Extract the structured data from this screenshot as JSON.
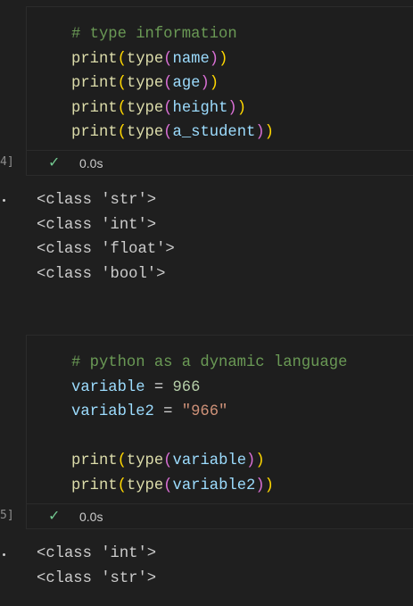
{
  "cells": [
    {
      "exec_count": "4]",
      "status_time": "0.0s",
      "code_lines": [
        [
          {
            "t": "# type information",
            "c": "c-comment"
          }
        ],
        [
          {
            "t": "print",
            "c": "c-func"
          },
          {
            "t": "(",
            "c": "c-p1"
          },
          {
            "t": "type",
            "c": "c-func"
          },
          {
            "t": "(",
            "c": "c-p2"
          },
          {
            "t": "name",
            "c": "c-var"
          },
          {
            "t": ")",
            "c": "c-p2"
          },
          {
            "t": ")",
            "c": "c-p1"
          }
        ],
        [
          {
            "t": "print",
            "c": "c-func"
          },
          {
            "t": "(",
            "c": "c-p1"
          },
          {
            "t": "type",
            "c": "c-func"
          },
          {
            "t": "(",
            "c": "c-p2"
          },
          {
            "t": "age",
            "c": "c-var"
          },
          {
            "t": ")",
            "c": "c-p2"
          },
          {
            "t": ")",
            "c": "c-p1"
          }
        ],
        [
          {
            "t": "print",
            "c": "c-func"
          },
          {
            "t": "(",
            "c": "c-p1"
          },
          {
            "t": "type",
            "c": "c-func"
          },
          {
            "t": "(",
            "c": "c-p2"
          },
          {
            "t": "height",
            "c": "c-var"
          },
          {
            "t": ")",
            "c": "c-p2"
          },
          {
            "t": ")",
            "c": "c-p1"
          }
        ],
        [
          {
            "t": "print",
            "c": "c-func"
          },
          {
            "t": "(",
            "c": "c-p1"
          },
          {
            "t": "type",
            "c": "c-func"
          },
          {
            "t": "(",
            "c": "c-p2"
          },
          {
            "t": "a_student",
            "c": "c-var"
          },
          {
            "t": ")",
            "c": "c-p2"
          },
          {
            "t": ")",
            "c": "c-p1"
          }
        ]
      ],
      "output_lines": [
        "<class 'str'>",
        "<class 'int'>",
        "<class 'float'>",
        "<class 'bool'>"
      ]
    },
    {
      "exec_count": "5]",
      "status_time": "0.0s",
      "code_lines": [
        [
          {
            "t": "# python as a dynamic language",
            "c": "c-comment"
          }
        ],
        [
          {
            "t": "variable",
            "c": "c-var"
          },
          {
            "t": " = ",
            "c": "c-op"
          },
          {
            "t": "966",
            "c": "c-num"
          }
        ],
        [
          {
            "t": "variable2",
            "c": "c-var"
          },
          {
            "t": " = ",
            "c": "c-op"
          },
          {
            "t": "\"966\"",
            "c": "c-str"
          }
        ],
        [],
        [
          {
            "t": "print",
            "c": "c-func"
          },
          {
            "t": "(",
            "c": "c-p1"
          },
          {
            "t": "type",
            "c": "c-func"
          },
          {
            "t": "(",
            "c": "c-p2"
          },
          {
            "t": "variable",
            "c": "c-var"
          },
          {
            "t": ")",
            "c": "c-p2"
          },
          {
            "t": ")",
            "c": "c-p1"
          }
        ],
        [
          {
            "t": "print",
            "c": "c-func"
          },
          {
            "t": "(",
            "c": "c-p1"
          },
          {
            "t": "type",
            "c": "c-func"
          },
          {
            "t": "(",
            "c": "c-p2"
          },
          {
            "t": "variable2",
            "c": "c-var"
          },
          {
            "t": ")",
            "c": "c-p2"
          },
          {
            "t": ")",
            "c": "c-p1"
          }
        ]
      ],
      "output_lines": [
        "<class 'int'>",
        "<class 'str'>"
      ]
    }
  ],
  "icons": {
    "status": "check-icon"
  },
  "colors": {
    "success": "#73c991",
    "comment": "#6a9955",
    "function": "#dcdcaa",
    "variable": "#9cdcfe",
    "number": "#b5cea8",
    "string": "#ce9178"
  }
}
